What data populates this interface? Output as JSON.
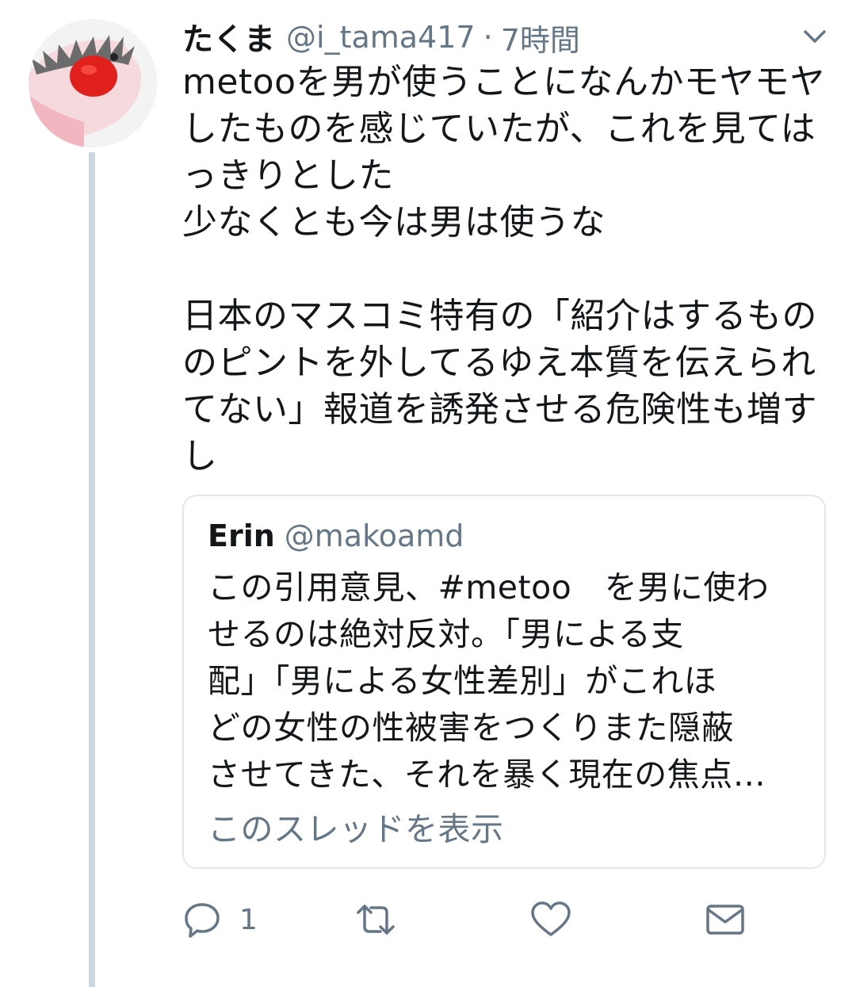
{
  "tweet": {
    "display_name": "たくま",
    "handle": "@i_tama417",
    "separator": "·",
    "time": "7時間",
    "text": "metooを男が使うことになんかモヤモヤ\nしたものを感じていたが、これを見ては\nっきりとした\n少なくとも今は男は使うな\n\n日本のマスコミ特有の「紹介はするもの\nのピントを外してるゆえ本質を伝えられ\nてない」報道を誘発させる危険性も増す\nし"
  },
  "quoted_tweet": {
    "display_name": "Erin",
    "handle": "@makoamd",
    "text": "この引用意見、#metoo　を男に使わ\nせるのは絶対反対。「男による支\n配」「男による女性差別」がこれほ\nどの女性の性被害をつくりまた隠蔽\nさせてきた、それを暴く現在の焦点…",
    "show_thread_label": "このスレッドを表示"
  },
  "actions": {
    "reply_count": "1"
  },
  "icons": {
    "avatar": "bird-avatar-image",
    "menu": "chevron-down-icon",
    "reply": "reply-icon",
    "retweet": "retweet-icon",
    "like": "heart-icon",
    "share": "envelope-icon"
  },
  "colors": {
    "text": "#14171a",
    "secondary_text": "#657786",
    "border": "#e1e8ed",
    "thread_line": "#ccd6dd",
    "avatar_accent": "#e0201c"
  }
}
